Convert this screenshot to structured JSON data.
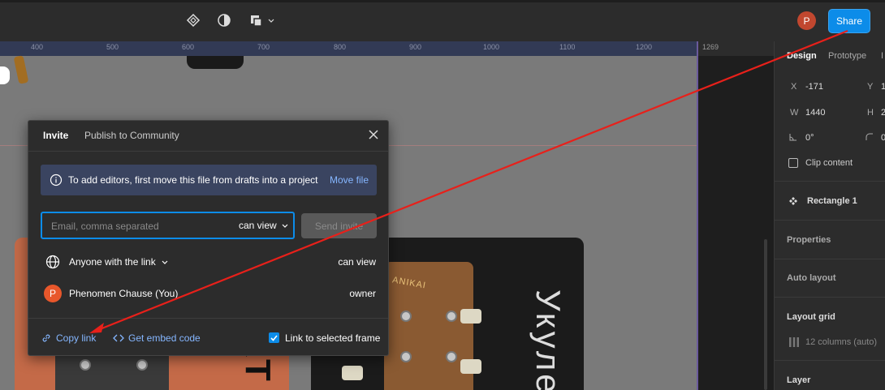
{
  "toolbar": {
    "icons": [
      "component-icon",
      "contrast-icon",
      "shape-menu-icon"
    ],
    "avatar_letter": "P",
    "share_label": "Share"
  },
  "ruler": {
    "ticks": [
      "400",
      "500",
      "600",
      "700",
      "800",
      "900",
      "1000",
      "1100",
      "1200"
    ],
    "right_value": "1269"
  },
  "dialog": {
    "tabs": [
      "Invite",
      "Publish to Community"
    ],
    "banner_text": "To add editors, first move this file from drafts into a project",
    "banner_link": "Move file",
    "email_placeholder": "Email, comma separated",
    "permission": "can view",
    "send_label": "Send invite",
    "anyone_label": "Anyone with the link",
    "anyone_permission": "can view",
    "owner_letter": "P",
    "owner_name": "Phenomen Chause (You)",
    "owner_role": "owner",
    "copy_link": "Copy link",
    "embed_code": "Get embed code",
    "link_selected": "Link to selected frame",
    "link_selected_checked": true
  },
  "canvas": {
    "card_left_text": "КТ",
    "card_right_text": "Укуле",
    "headstock_brand": "ANIKAI"
  },
  "panel": {
    "tabs": [
      "Design",
      "Prototype",
      "I"
    ],
    "x_label": "X",
    "x_value": "-171",
    "y_label": "Y",
    "y_value": "1",
    "w_label": "W",
    "w_value": "1440",
    "h_label": "H",
    "h_value": "2",
    "rotation_value": "0°",
    "radius_value": "0",
    "clip_content": "Clip content",
    "layer_name": "Rectangle 1",
    "properties": "Properties",
    "auto_layout": "Auto layout",
    "layout_grid": "Layout grid",
    "grid_value": "12 columns (auto)",
    "layer": "Layer"
  },
  "colors": {
    "accent": "#0c8ce9",
    "link": "#85b6ff",
    "annotation_arrow": "#e8201a"
  }
}
